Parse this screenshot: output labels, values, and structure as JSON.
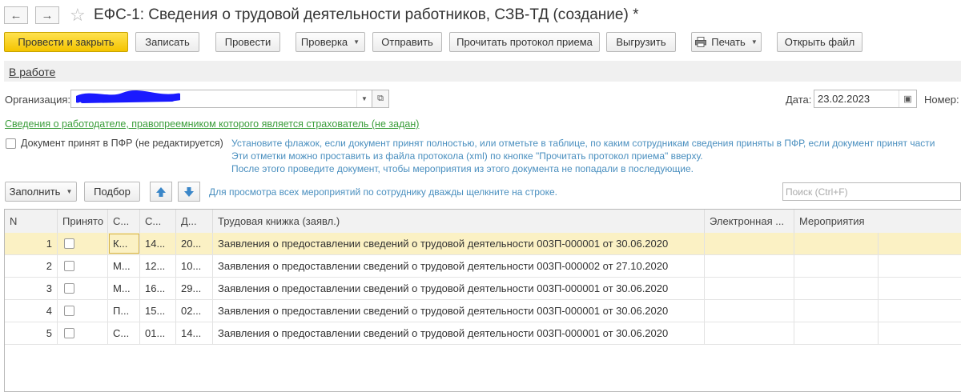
{
  "header": {
    "title": "ЕФС-1: Сведения о трудовой деятельности работников, СЗВ-ТД (создание) *"
  },
  "toolbar": {
    "post_close": "Провести и закрыть",
    "save": "Записать",
    "post": "Провести",
    "check": "Проверка",
    "send": "Отправить",
    "read_protocol": "Прочитать протокол приема",
    "export": "Выгрузить",
    "print": "Печать",
    "open_file": "Открыть файл"
  },
  "status": "В работе",
  "form": {
    "org_label": "Организация:",
    "org_value": "",
    "date_label": "Дата:",
    "date_value": "23.02.2023",
    "number_label": "Номер:",
    "successor_link": "Сведения о работодателе, правопреемником которого является страхователь (не задан)",
    "accepted_label": "Документ принят в ПФР (не редактируется)",
    "hint_lines": [
      "Установите флажок, если документ принят полностью, или отметьте в таблице, по каким сотрудникам сведения приняты в ПФР, если документ принят части",
      "Эти отметки можно проставить из файла протокола (xml) по кнопке \"Прочитать протокол приема\" вверху.",
      "После этого проведите документ, чтобы мероприятия из этого документа не попадали в последующие."
    ]
  },
  "table_toolbar": {
    "fill": "Заполнить",
    "pick": "Подбор",
    "hint": "Для просмотра всех мероприятий по сотруднику дважды щелкните на строке.",
    "search_placeholder": "Поиск (Ctrl+F)"
  },
  "table": {
    "columns": [
      "N",
      "Принято",
      "С...",
      "С...",
      "Д...",
      "Трудовая книжка (заявл.)",
      "Электронная ...",
      "Мероприятия"
    ],
    "rows": [
      {
        "n": "1",
        "c1": "К...",
        "c2": "14...",
        "d": "20...",
        "book": "Заявления о предоставлении сведений о трудовой деятельности 003П-000001 от 30.06.2020"
      },
      {
        "n": "2",
        "c1": "М...",
        "c2": "12...",
        "d": "10...",
        "book": "Заявления о предоставлении сведений о трудовой деятельности 003П-000002 от 27.10.2020"
      },
      {
        "n": "3",
        "c1": "М...",
        "c2": "16...",
        "d": "29...",
        "book": "Заявления о предоставлении сведений о трудовой деятельности 003П-000001 от 30.06.2020"
      },
      {
        "n": "4",
        "c1": "П...",
        "c2": "15...",
        "d": "02...",
        "book": "Заявления о предоставлении сведений о трудовой деятельности 003П-000001 от 30.06.2020"
      },
      {
        "n": "5",
        "c1": "С...",
        "c2": "01...",
        "d": "14...",
        "book": "Заявления о предоставлении сведений о трудовой деятельности 003П-000001 от 30.06.2020"
      }
    ]
  },
  "colors": {
    "primary_button": "#f4c400",
    "selected_row": "#fbf1c4",
    "hint_text": "#4a8fbf",
    "link_green": "#3a9d3a",
    "scribble": "#1a1aff"
  }
}
